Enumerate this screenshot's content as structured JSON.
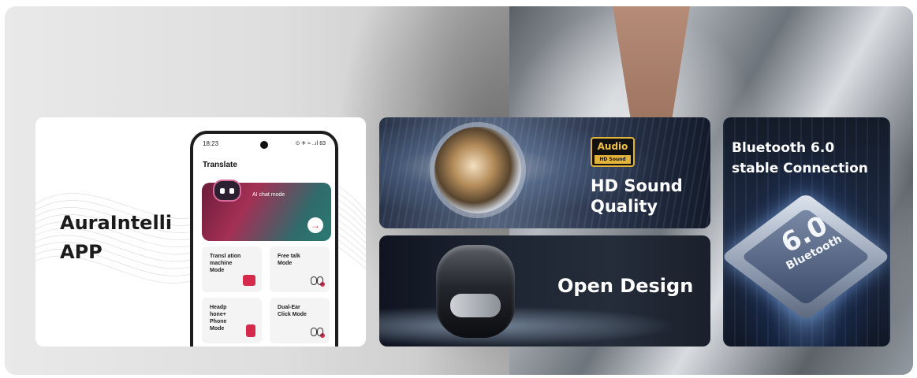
{
  "app_card": {
    "title": "AuraIntelli APP",
    "phone": {
      "time": "18:23",
      "status_icons": "⊙ ✈ ≈ ..ıl 83",
      "screen_title": "Translate",
      "ai_card_label": "AI chat mode",
      "modes": [
        {
          "label": "Transl ation machine Mode",
          "icon": "translator-icon"
        },
        {
          "label": "Free talk Mode",
          "icon": "earbuds-icon"
        },
        {
          "label": "Headp hone+ Phone Mode",
          "icon": "phone-icon"
        },
        {
          "label": "Dual-Ear Click Mode",
          "icon": "earbuds-icon"
        }
      ]
    }
  },
  "features": {
    "hd_sound": {
      "badge_top": "Audio",
      "badge_bottom": "HD Sound",
      "title": "HD Sound Quality"
    },
    "open_design": {
      "title": "Open Design"
    },
    "bluetooth": {
      "title": "Bluetooth 6.0 stable Connection",
      "chip_version": "6.0",
      "chip_name": "Bluetooth"
    }
  },
  "colors": {
    "accent_red": "#d62a4d",
    "badge_gold": "#e2b33a",
    "dark_card": "#1f2633"
  }
}
